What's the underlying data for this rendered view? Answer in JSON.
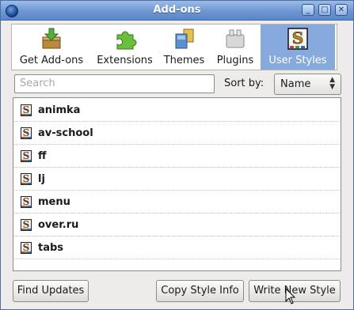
{
  "window": {
    "title": "Add-ons"
  },
  "toolbar": {
    "items": [
      {
        "label": "Get Add-ons",
        "icon": "get-addons-icon"
      },
      {
        "label": "Extensions",
        "icon": "puzzle-icon"
      },
      {
        "label": "Themes",
        "icon": "themes-icon"
      },
      {
        "label": "Plugins",
        "icon": "plugin-icon"
      },
      {
        "label": "User Styles",
        "icon": "stylish-icon",
        "selected": true
      }
    ]
  },
  "search": {
    "placeholder": "Search"
  },
  "sort": {
    "label": "Sort by:",
    "value": "Name"
  },
  "styles": [
    {
      "name": "animka"
    },
    {
      "name": "av-school"
    },
    {
      "name": "ff"
    },
    {
      "name": "lj"
    },
    {
      "name": "menu"
    },
    {
      "name": "over.ru"
    },
    {
      "name": "tabs"
    }
  ],
  "buttons": {
    "find_updates": "Find Updates",
    "copy_style_info": "Copy Style Info",
    "write_new_style": "Write New Style"
  },
  "colors": {
    "titlebar": "#6d97d3",
    "selected_tab": "#86aadd",
    "window_bg": "#edeceb"
  }
}
